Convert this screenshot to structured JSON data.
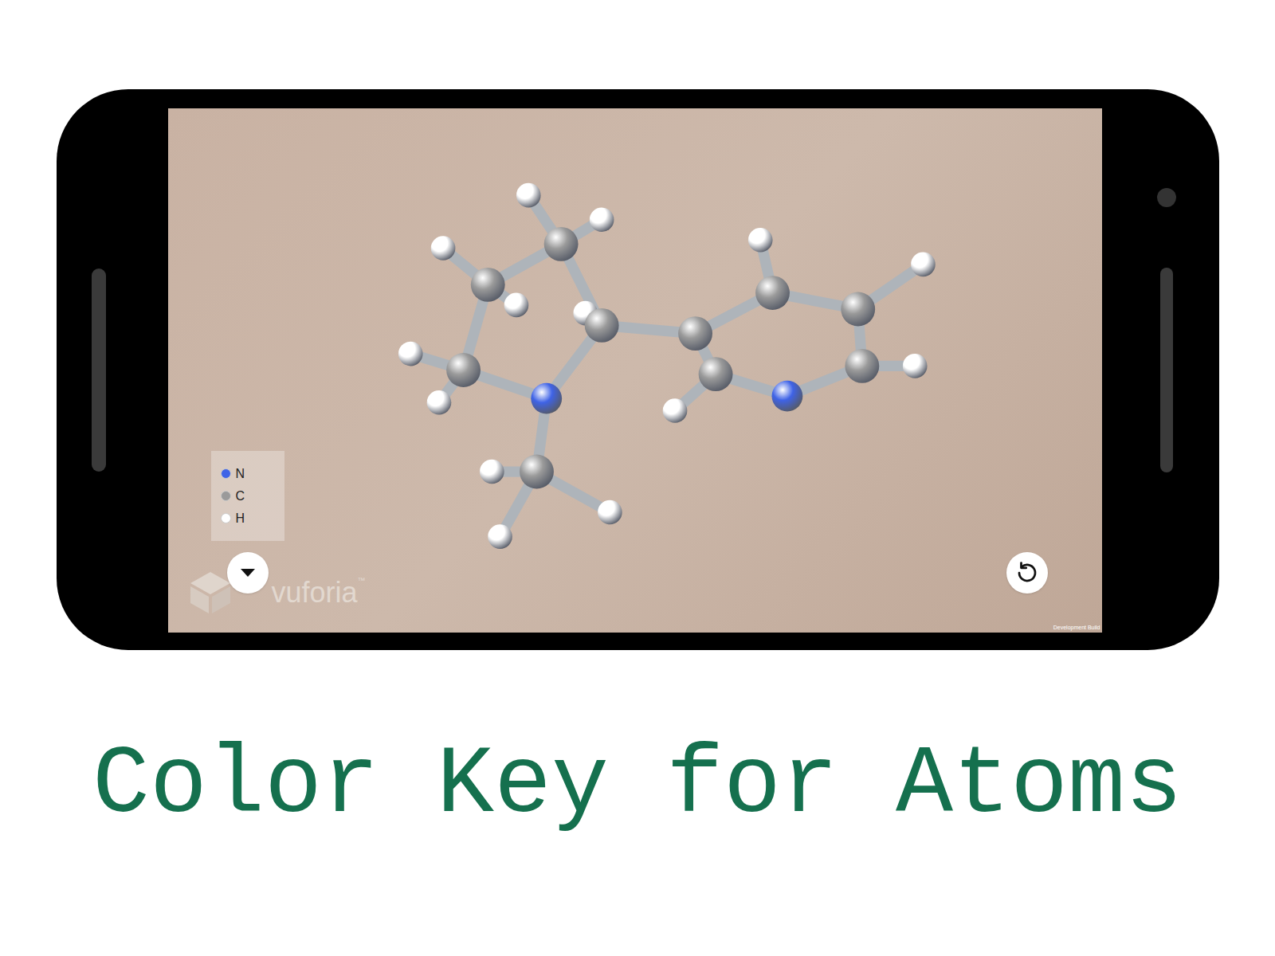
{
  "app": {
    "watermark": "vuforia",
    "watermark_mark": "™",
    "build_label": "Development Build"
  },
  "legend": [
    {
      "symbol": "N",
      "color": "#3f63e6"
    },
    {
      "symbol": "C",
      "color": "#9a9a9a"
    },
    {
      "symbol": "H",
      "color": "#ffffff"
    }
  ],
  "caption": "Color Key for Atoms"
}
